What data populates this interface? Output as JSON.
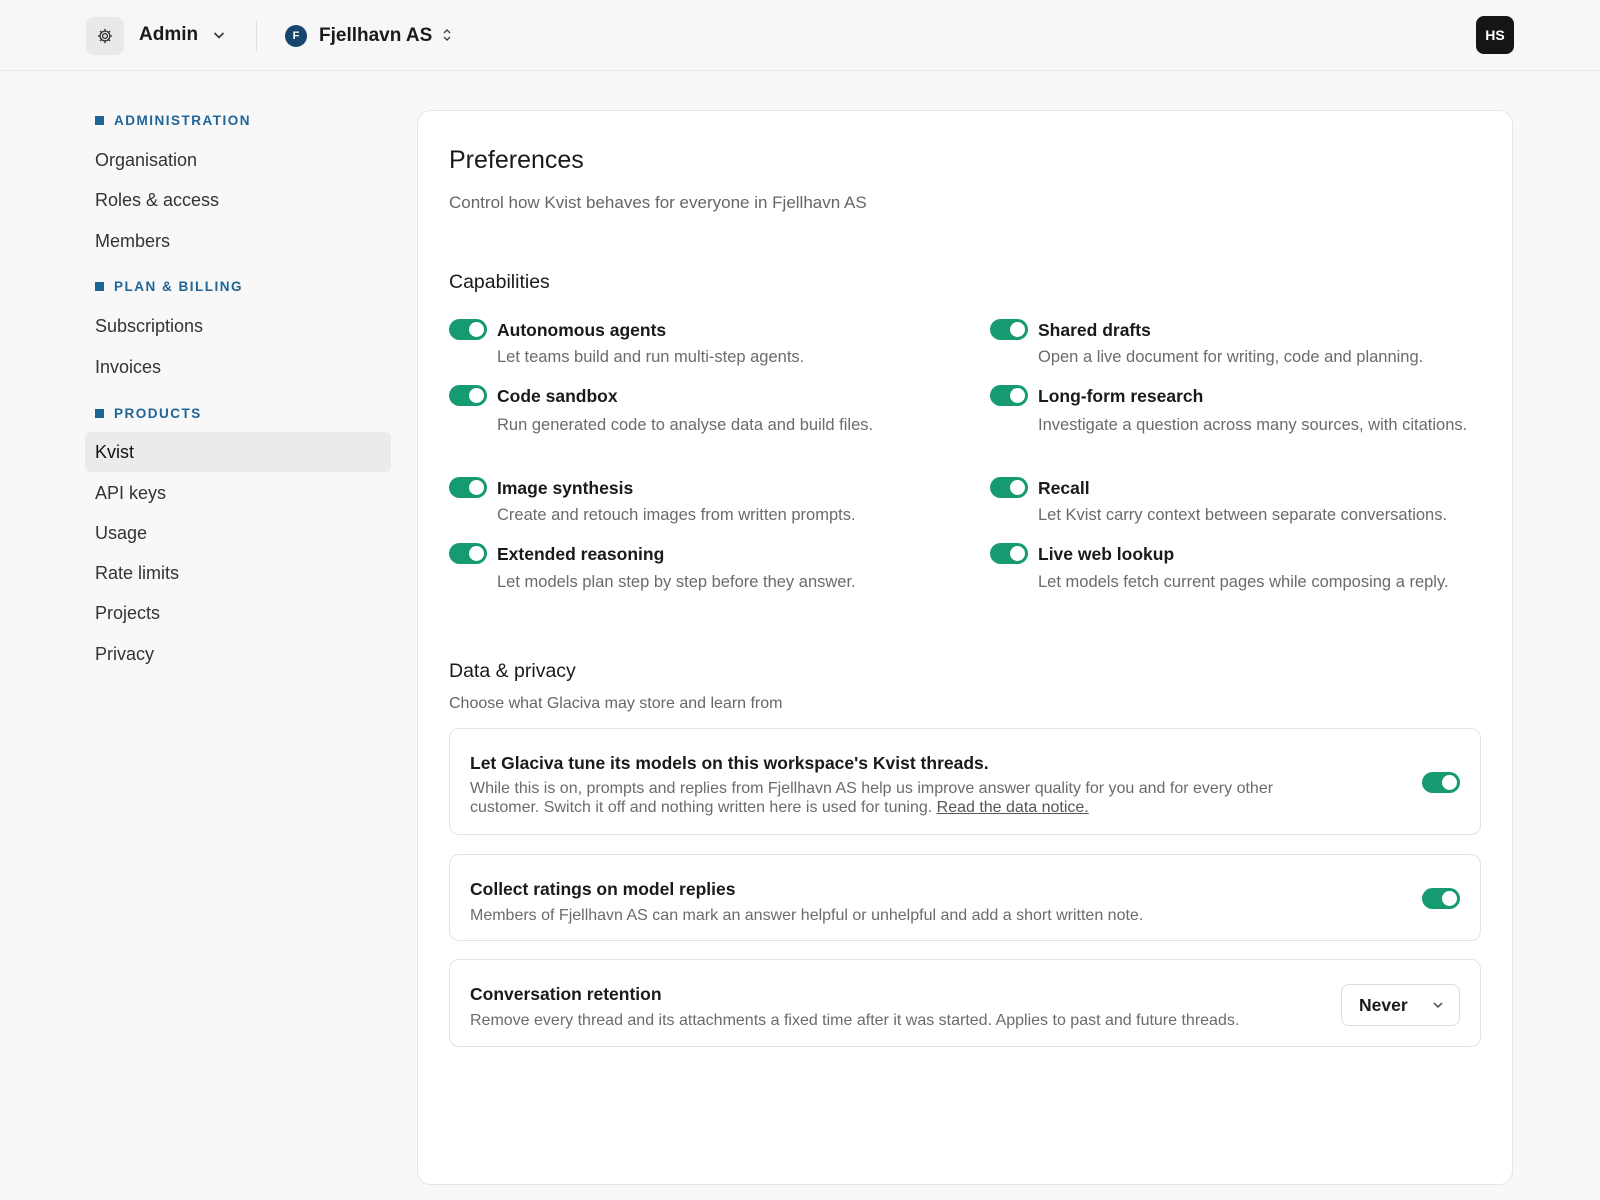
{
  "header": {
    "app_icon": "gear-icon",
    "app_name": "Admin",
    "org_initial": "F",
    "org_name": "Fjellhavn AS",
    "user_initials": "HS"
  },
  "sidebar": {
    "sections": [
      {
        "label": "ADMINISTRATION",
        "items": [
          "Organisation",
          "Roles & access",
          "Members"
        ]
      },
      {
        "label": "PLAN & BILLING",
        "items": [
          "Subscriptions",
          "Invoices"
        ]
      },
      {
        "label": "PRODUCTS",
        "items": [
          "Kvist",
          "API keys",
          "Usage",
          "Rate limits",
          "Projects",
          "Privacy"
        ]
      }
    ],
    "active_item": "Kvist"
  },
  "main": {
    "title": "Preferences",
    "subtitle": "Control how Kvist behaves for everyone in Fjellhavn AS",
    "capabilities": {
      "title": "Capabilities",
      "items": [
        {
          "name": "Autonomous agents",
          "desc": "Let teams build and run multi-step agents.",
          "on": true
        },
        {
          "name": "Shared drafts",
          "desc": "Open a live document for writing, code and planning.",
          "on": true
        },
        {
          "name": "Code sandbox",
          "desc": "Run generated code to analyse data and build files.",
          "on": true
        },
        {
          "name": "Long-form research",
          "desc": "Investigate a question across many sources, with citations.",
          "on": true
        },
        {
          "name": "Image synthesis",
          "desc": "Create and retouch images from written prompts.",
          "on": true
        },
        {
          "name": "Recall",
          "desc": "Let Kvist carry context between separate conversations.",
          "on": true
        },
        {
          "name": "Extended reasoning",
          "desc": "Let models plan step by step before they answer.",
          "on": true
        },
        {
          "name": "Live web lookup",
          "desc": "Let models fetch current pages while composing a reply.",
          "on": true
        }
      ]
    },
    "privacy": {
      "title": "Data & privacy",
      "subtitle": "Choose what Glaciva may store and learn from",
      "tuning": {
        "title": "Let Glaciva tune its models on this workspace's Kvist threads.",
        "desc": "While this is on, prompts and replies from Fjellhavn AS help us improve answer quality for you and for every other customer. Switch it off and nothing written here is used for tuning.",
        "link": "Read the data notice.",
        "on": true
      },
      "ratings": {
        "title": "Collect ratings on model replies",
        "desc": "Members of Fjellhavn AS can mark an answer helpful or unhelpful and add a short written note.",
        "on": true
      },
      "retention": {
        "title": "Conversation retention",
        "desc": "Remove every thread and its attachments a fixed time after it was started. Applies to past and future threads.",
        "value": "Never"
      }
    }
  },
  "colors": {
    "accent": "#169a72",
    "section_label": "#1e6497",
    "org_avatar": "#17456e"
  }
}
